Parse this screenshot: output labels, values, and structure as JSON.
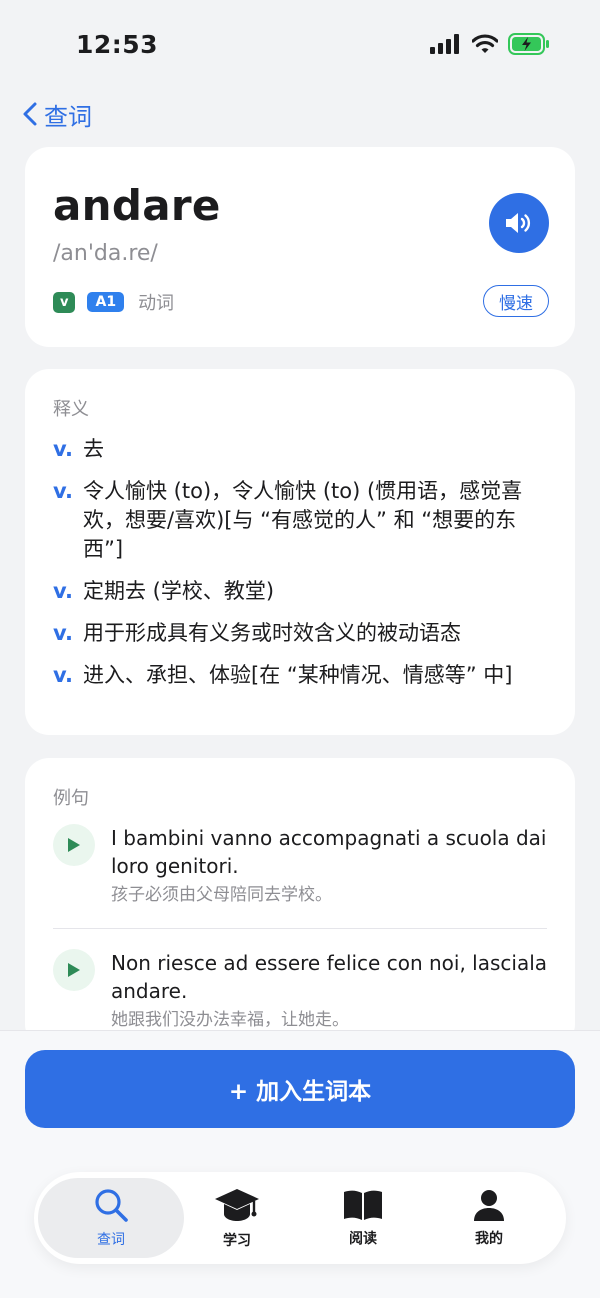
{
  "status_bar": {
    "time": "12:53"
  },
  "nav": {
    "back_label": "查词"
  },
  "word": {
    "headword": "andare",
    "phonetic": "/an'da.re/",
    "pos_tag": "v",
    "level_tag": "A1",
    "pos_text": "动词",
    "slow_label": "慢速"
  },
  "definitions": {
    "label": "释义",
    "items": [
      {
        "pos": "v.",
        "text": "去"
      },
      {
        "pos": "v.",
        "text": "令人愉快 (to)，令人愉快 (to) (惯用语，感觉喜欢，想要/喜欢)[与 “有感觉的人” 和 “想要的东西”]"
      },
      {
        "pos": "v.",
        "text": "定期去 (学校、教堂)"
      },
      {
        "pos": "v.",
        "text": "用于形成具有义务或时效含义的被动语态"
      },
      {
        "pos": "v.",
        "text": "进入、承担、体验[在 “某种情况、情感等” 中]"
      }
    ]
  },
  "examples": {
    "label": "例句",
    "items": [
      {
        "it": "I bambini vanno accompagnati a scuola dai loro genitori.",
        "cn": "孩子必须由父母陪同去学校。"
      },
      {
        "it": "Non riesce ad essere felice con noi, lasciala andare.",
        "cn": "她跟我们没办法幸福，让她走。"
      }
    ]
  },
  "actions": {
    "add_label": "+ 加入生词本"
  },
  "tabs": [
    {
      "label": "查词",
      "icon": "search-icon",
      "active": true
    },
    {
      "label": "学习",
      "icon": "graduation-cap-icon",
      "active": false
    },
    {
      "label": "阅读",
      "icon": "book-icon",
      "active": false
    },
    {
      "label": "我的",
      "icon": "person-icon",
      "active": false
    }
  ],
  "colors": {
    "accent": "#2f6fe4",
    "pos_tag": "#2e8b57",
    "level_tag": "#2f80ed",
    "play_bg": "#eaf6ee",
    "play_icon": "#2e8b57"
  }
}
